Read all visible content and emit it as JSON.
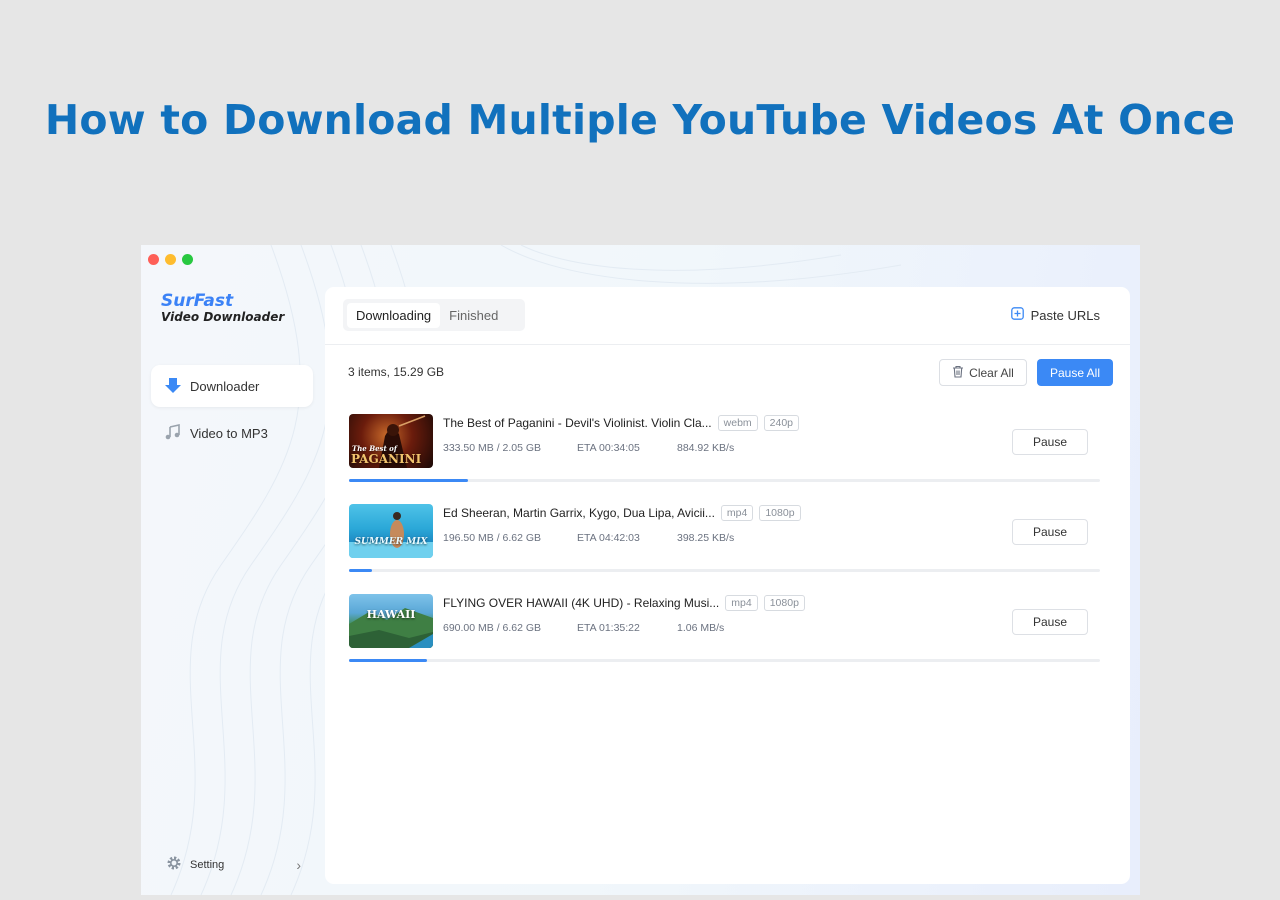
{
  "headline": "How to Download Multiple YouTube Videos At Once",
  "app": {
    "logo_main": "SurFast",
    "logo_sub": "Video Downloader",
    "accent": "#3b89f5"
  },
  "sidebar": {
    "items": [
      {
        "label": "Downloader",
        "icon": "download-arrow-icon"
      },
      {
        "label": "Video to MP3",
        "icon": "music-note-icon"
      }
    ],
    "setting_label": "Setting"
  },
  "tabs": [
    {
      "label": "Downloading"
    },
    {
      "label": "Finished"
    }
  ],
  "paste_urls_label": "Paste URLs",
  "summary": "3 items, 15.29 GB",
  "clear_all_label": "Clear All",
  "pause_all_label": "Pause All",
  "downloads": [
    {
      "title": "The Best of Paganini - Devil's Violinist. Violin Cla...",
      "format": "webm",
      "quality": "240p",
      "size": "333.50 MB / 2.05 GB",
      "eta": "ETA 00:34:05",
      "speed": "884.92 KB/s",
      "pause_label": "Pause",
      "progress": 0.159,
      "thumb_caption_small": "The Best of",
      "thumb_caption": "PAGANINI"
    },
    {
      "title": "Ed Sheeran, Martin Garrix, Kygo, Dua Lipa, Avicii...",
      "format": "mp4",
      "quality": "1080p",
      "size": "196.50 MB / 6.62 GB",
      "eta": "ETA 04:42:03",
      "speed": "398.25 KB/s",
      "pause_label": "Pause",
      "progress": 0.03,
      "thumb_caption": "SUMMER MIX"
    },
    {
      "title": "FLYING OVER HAWAII (4K UHD) - Relaxing Musi...",
      "format": "mp4",
      "quality": "1080p",
      "size": "690.00 MB / 6.62 GB",
      "eta": "ETA 01:35:22",
      "speed": "1.06 MB/s",
      "pause_label": "Pause",
      "progress": 0.104,
      "thumb_caption": "HAWAII"
    }
  ]
}
